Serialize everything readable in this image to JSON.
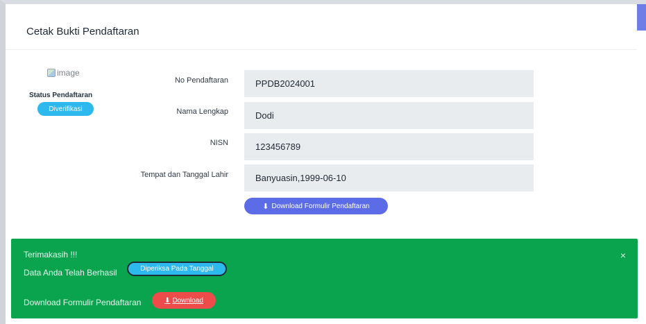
{
  "card": {
    "title": "Cetak Bukti Pendaftaran"
  },
  "profile": {
    "image_alt": "image",
    "status_label": "Status Pendaftaran",
    "status_value": "Diverifikasi"
  },
  "fields": [
    {
      "label": "No Pendaftaran",
      "value": "PPDB2024001"
    },
    {
      "label": "Nama Lengkap",
      "value": "Dodi"
    },
    {
      "label": "NISN",
      "value": "123456789"
    },
    {
      "label": "Tempat dan Tanggal Lahir",
      "value": "Banyuasin,1999-06-10"
    }
  ],
  "download_button": {
    "label": "Download Formulir Pendaftaran",
    "icon": "download-icon"
  },
  "alert": {
    "title": "Terimakasih !!!",
    "line1": "Data Anda Telah Berhasil",
    "check_button": "Diperiksa Pada Tanggal",
    "line2": "Download Formulir Pendaftaran",
    "download_label": "Download",
    "close": "×"
  },
  "colors": {
    "accent": "#5c6ce6",
    "success": "#0aa44f",
    "info": "#2db8ee",
    "danger": "#ee4b4b"
  }
}
